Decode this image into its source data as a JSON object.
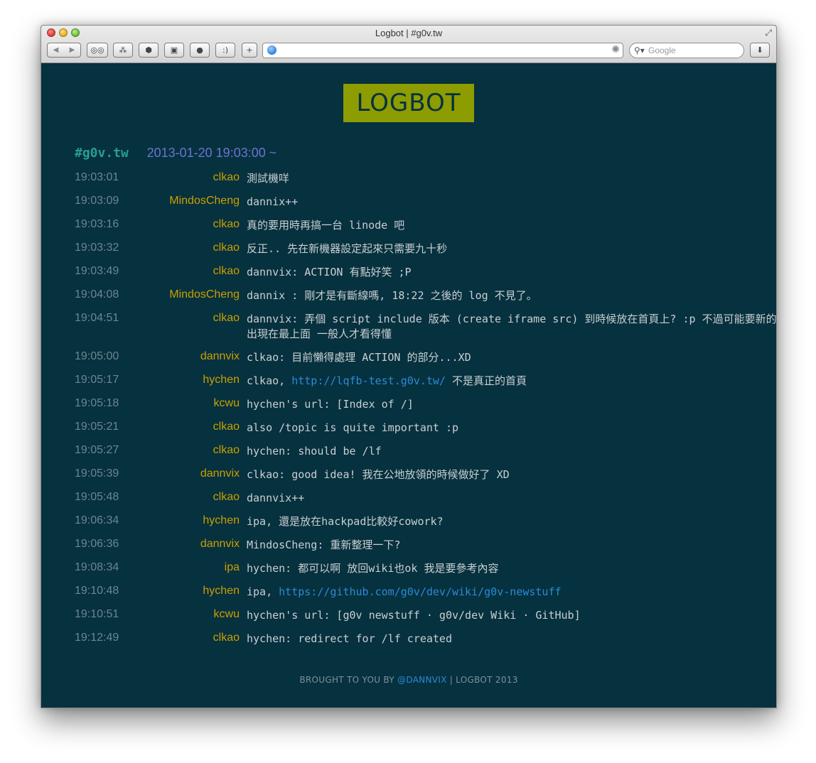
{
  "window": {
    "title": "Logbot | #g0v.tw"
  },
  "toolbar": {
    "back_icon": "◀",
    "forward_icon": "▶",
    "reader_icon": "reading-glasses-icon",
    "add_label": "+",
    "search_placeholder": "Google"
  },
  "page": {
    "logo": "LOGBOT",
    "channel": "#g0v.tw",
    "date": "2013-01-20 19:03:00 ~"
  },
  "log": [
    {
      "time": "19:03:01",
      "nick": "clkao",
      "msg": "測試機咩"
    },
    {
      "time": "19:03:09",
      "nick": "MindosCheng",
      "msg": "dannix++"
    },
    {
      "time": "19:03:16",
      "nick": "clkao",
      "msg": "真的要用時再搞一台 linode 吧"
    },
    {
      "time": "19:03:32",
      "nick": "clkao",
      "msg": "反正.. 先在新機器設定起來只需要九十秒"
    },
    {
      "time": "19:03:49",
      "nick": "clkao",
      "msg": "dannvix: ACTION 有點好笑 ;P"
    },
    {
      "time": "19:04:08",
      "nick": "MindosCheng",
      "msg": "dannix : 剛才是有斷線嗎, 18:22 之後的 log 不見了。"
    },
    {
      "time": "19:04:51",
      "nick": "clkao",
      "msg": "dannvix: 弄個 script include 版本 (create iframe src) 到時候放在首頁上? :p 不過可能要新的出現在最上面 一般人才看得懂"
    },
    {
      "time": "19:05:00",
      "nick": "dannvix",
      "msg": "clkao: 目前懶得處理 ACTION 的部分...XD"
    },
    {
      "time": "19:05:17",
      "nick": "hychen",
      "msg_pre": "clkao, ",
      "link": "http://lqfb-test.g0v.tw/",
      "msg_post": " 不是真正的首頁"
    },
    {
      "time": "19:05:18",
      "nick": "kcwu",
      "msg": "hychen's url: [Index of /]"
    },
    {
      "time": "19:05:21",
      "nick": "clkao",
      "msg": "also /topic is quite important :p"
    },
    {
      "time": "19:05:27",
      "nick": "clkao",
      "msg": "hychen: should be /lf"
    },
    {
      "time": "19:05:39",
      "nick": "dannvix",
      "msg": "clkao: good idea! 我在公地放領的時候做好了 XD"
    },
    {
      "time": "19:05:48",
      "nick": "clkao",
      "msg": "dannvix++"
    },
    {
      "time": "19:06:34",
      "nick": "hychen",
      "msg": "ipa, 還是放在hackpad比較好cowork?"
    },
    {
      "time": "19:06:36",
      "nick": "dannvix",
      "msg": "MindosCheng: 重新整理一下?"
    },
    {
      "time": "19:08:34",
      "nick": "ipa",
      "msg": "hychen: 都可以啊 放回wiki也ok 我是要參考內容"
    },
    {
      "time": "19:10:48",
      "nick": "hychen",
      "msg_pre": "ipa, ",
      "link": "https://github.com/g0v/dev/wiki/g0v-newstuff",
      "msg_post": ""
    },
    {
      "time": "19:10:51",
      "nick": "kcwu",
      "msg": "hychen's url: [g0v newstuff · g0v/dev Wiki · GitHub]"
    },
    {
      "time": "19:12:49",
      "nick": "clkao",
      "msg": "hychen: redirect for /lf created"
    }
  ],
  "footer": {
    "prefix": "BROUGHT TO YOU BY ",
    "link": "@DANNVIX",
    "suffix": " | LOGBOT 2013"
  }
}
